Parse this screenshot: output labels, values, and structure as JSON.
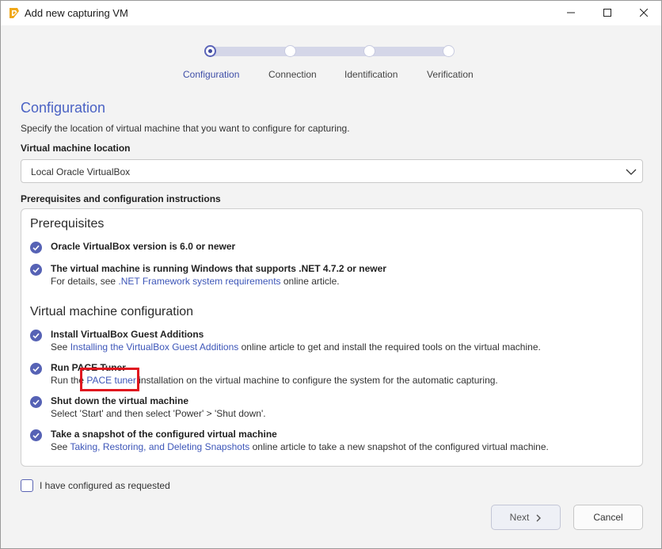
{
  "window": {
    "title": "Add new capturing VM"
  },
  "stepper": {
    "steps": [
      {
        "label": "Configuration"
      },
      {
        "label": "Connection"
      },
      {
        "label": "Identification"
      },
      {
        "label": "Verification"
      }
    ],
    "active_index": 0
  },
  "main": {
    "title": "Configuration",
    "description": "Specify the location of virtual machine that you want to configure for capturing.",
    "location_label": "Virtual machine location",
    "location_value": "Local Oracle VirtualBox",
    "instructions_label": "Prerequisites and configuration instructions"
  },
  "prerequisites": {
    "heading": "Prerequisites",
    "items": [
      {
        "title": "Oracle VirtualBox version is 6.0 or newer"
      },
      {
        "title": "The virtual machine is running Windows that supports .NET 4.7.2 or newer",
        "desc_before": "For details, see ",
        "link": ".NET Framework system requirements",
        "desc_after": " online article."
      }
    ]
  },
  "vm_config": {
    "heading": "Virtual machine configuration",
    "items": [
      {
        "title": "Install VirtualBox Guest Additions",
        "desc_before": "See ",
        "link": "Installing the VirtualBox Guest Additions",
        "desc_after": " online article to get and install the required tools on the virtual machine."
      },
      {
        "title": "Run PACE Tuner",
        "desc_before": "Run the ",
        "link": "PACE tuner",
        "desc_after": " installation on the virtual machine to configure the system for the automatic capturing."
      },
      {
        "title": "Shut down the virtual machine",
        "desc": "Select 'Start' and then select 'Power' > 'Shut down'."
      },
      {
        "title": "Take a snapshot of the configured virtual machine",
        "desc_before": "See ",
        "link": "Taking, Restoring, and Deleting Snapshots",
        "desc_after": " online article to take a new snapshot of the configured virtual machine."
      }
    ]
  },
  "footer": {
    "confirm_label": "I have configured as requested",
    "confirm_checked": false,
    "next_label": "Next",
    "cancel_label": "Cancel"
  },
  "colors": {
    "accent": "#4a62c4",
    "link": "#3d56b8",
    "check": "#5662b5",
    "highlight": "#e0161f"
  },
  "icons": {
    "app": "pace-logo-icon",
    "minimize": "minimize-icon",
    "maximize": "maximize-icon",
    "close": "close-icon",
    "dropdown": "chevron-down-icon",
    "check": "check-circle-icon",
    "next": "chevron-right-icon"
  }
}
